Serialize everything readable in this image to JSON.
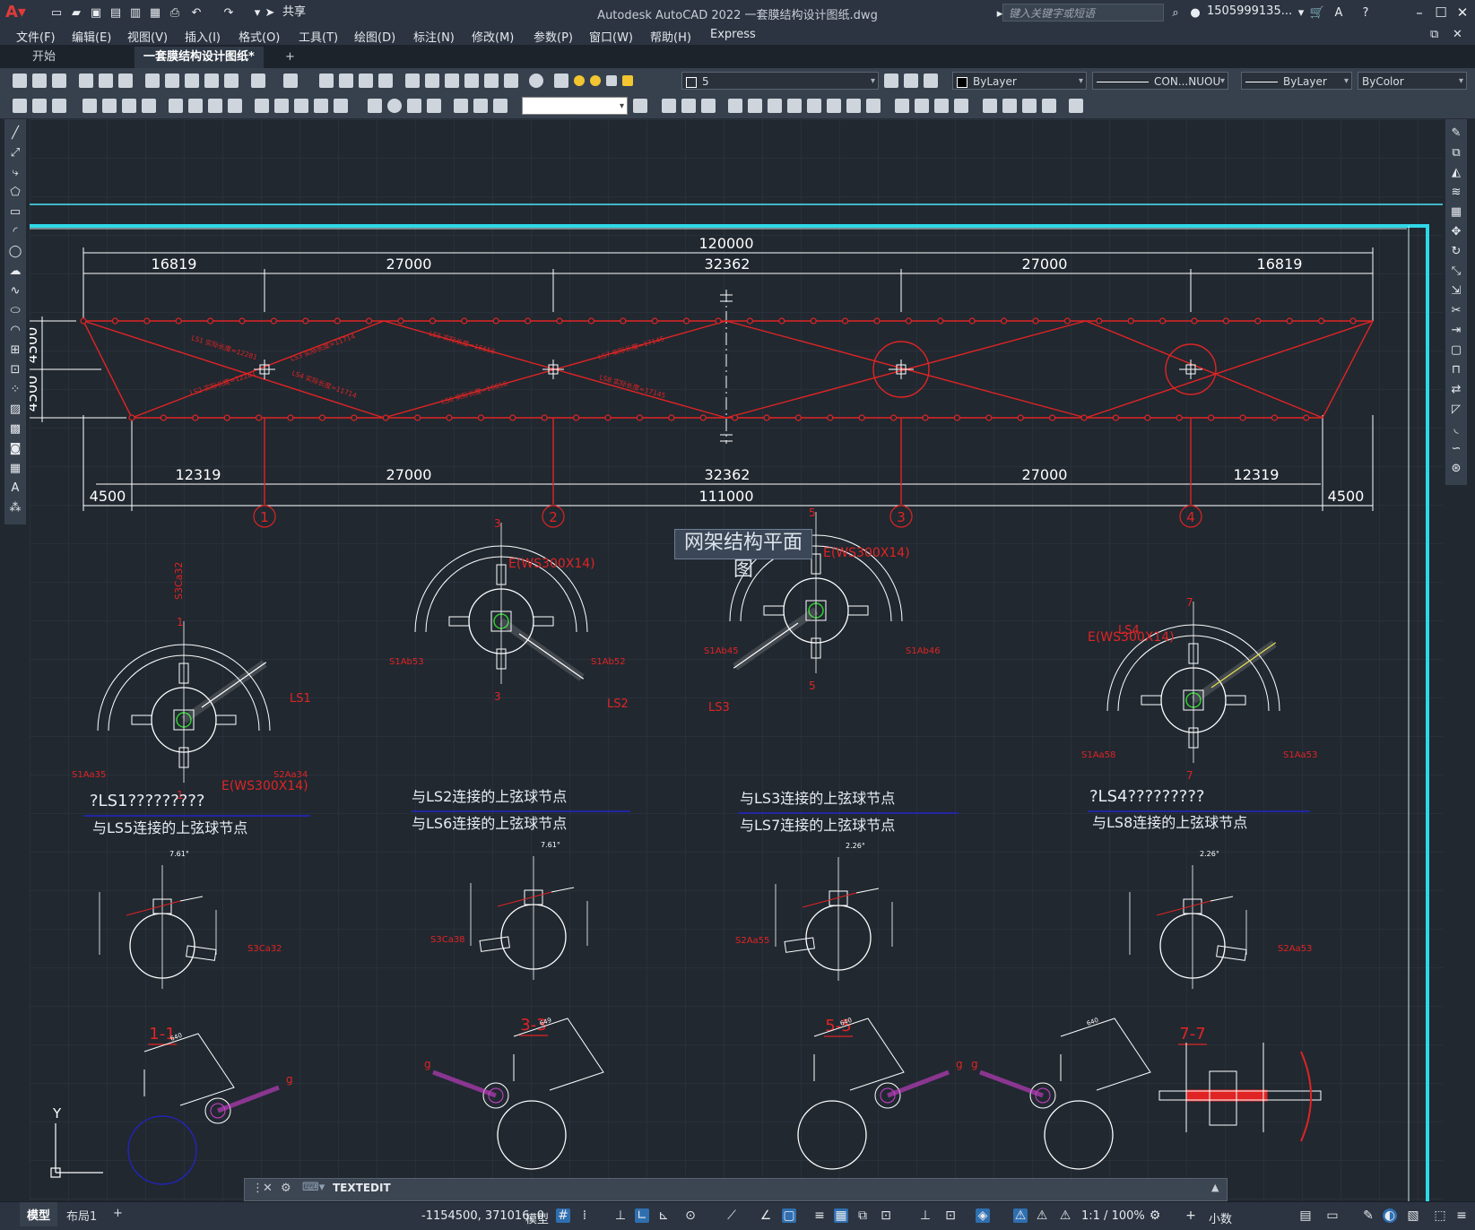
{
  "window": {
    "app_title": "Autodesk AutoCAD 2022    一套膜结构设计图纸.dwg",
    "share_label": "共享",
    "search_placeholder": "键入关键字或短语",
    "user": "1505999135...",
    "accent": "#e03a3a"
  },
  "menu": [
    "文件(F)",
    "编辑(E)",
    "视图(V)",
    "插入(I)",
    "格式(O)",
    "工具(T)",
    "绘图(D)",
    "标注(N)",
    "修改(M)",
    "参数(P)",
    "窗口(W)",
    "帮助(H)",
    "Express"
  ],
  "tabs": {
    "start": "开始",
    "doc": "一套膜结构设计图纸*",
    "add": "+"
  },
  "toolbar": {
    "layer_value": "5",
    "color_value": "ByLayer",
    "linetype_value": "CON...NUOU",
    "lineweight_value": "ByLayer",
    "plotstyle_value": "ByColor",
    "dimstyle_value": ""
  },
  "drawing": {
    "plan_title": "网架结构平面图",
    "dims_top": [
      "120000",
      "16819",
      "27000",
      "32362",
      "27000",
      "16819"
    ],
    "dims_bottom": [
      "12319",
      "27000",
      "32362",
      "27000",
      "12319",
      "4500",
      "111000",
      "4500"
    ],
    "dims_left": [
      "4500",
      "4500"
    ],
    "axis_labels": [
      "1",
      "2",
      "3",
      "4"
    ],
    "member_labels": [
      "LS1 实际长度=12281",
      "LS2 实际长度=12281",
      "LS3 实际长度=11714",
      "LS4 实际长度=11714",
      "LS5 实际长度=16656",
      "LS6 实际长度=16656",
      "LS7 实际长度=17145",
      "LS8 实际长度=17145"
    ],
    "node_details": [
      {
        "ls": "LS1",
        "ball": "E(WS300X14)",
        "left": "S1Aa35",
        "right": "S2Aa34",
        "top": "S3Ca32",
        "sec": "1"
      },
      {
        "ls": "LS2",
        "ball": "E(WS300X14)",
        "left": "S1Ab53",
        "right": "S1Ab52",
        "top": "",
        "sec": "3"
      },
      {
        "ls": "LS3",
        "ball": "E(WS300X14)",
        "left": "S1Ab45",
        "right": "S1Ab46",
        "top": "",
        "sec": "5"
      },
      {
        "ls": "LS4",
        "ball": "E(WS300X14)",
        "left": "S1Aa58",
        "right": "S1Aa53",
        "top": "",
        "sec": "7"
      }
    ],
    "captions": [
      [
        "?LS1?????????",
        "与LS5连接的上弦球节点"
      ],
      [
        "与LS2连接的上弦球节点",
        "与LS6连接的上弦球节点"
      ],
      [
        "与LS3连接的上弦球节点",
        "与LS7连接的上弦球节点"
      ],
      [
        "?LS4?????????",
        "与LS8连接的上弦球节点"
      ]
    ],
    "section_labels": [
      "1-1",
      "3-3",
      "5-5",
      "7-7"
    ],
    "section_side_labels": [
      "S3Ca32",
      "S3Ca38",
      "S2Aa55",
      "S2Aa53"
    ],
    "section_angles": [
      "7.61°",
      "7.61°",
      "2.26°",
      "2.26°"
    ],
    "bottom_marks": [
      "g",
      "g",
      "g",
      "g"
    ],
    "dim_small": [
      "640",
      "649",
      "640",
      "640"
    ]
  },
  "command": {
    "text": "TEXTEDIT"
  },
  "status": {
    "model_tab": "模型",
    "layout_tab": "布局1",
    "coords": "-1154500, 371016, 0",
    "model_btn": "模型",
    "scale": "1:1 / 100%",
    "units": "小数"
  }
}
